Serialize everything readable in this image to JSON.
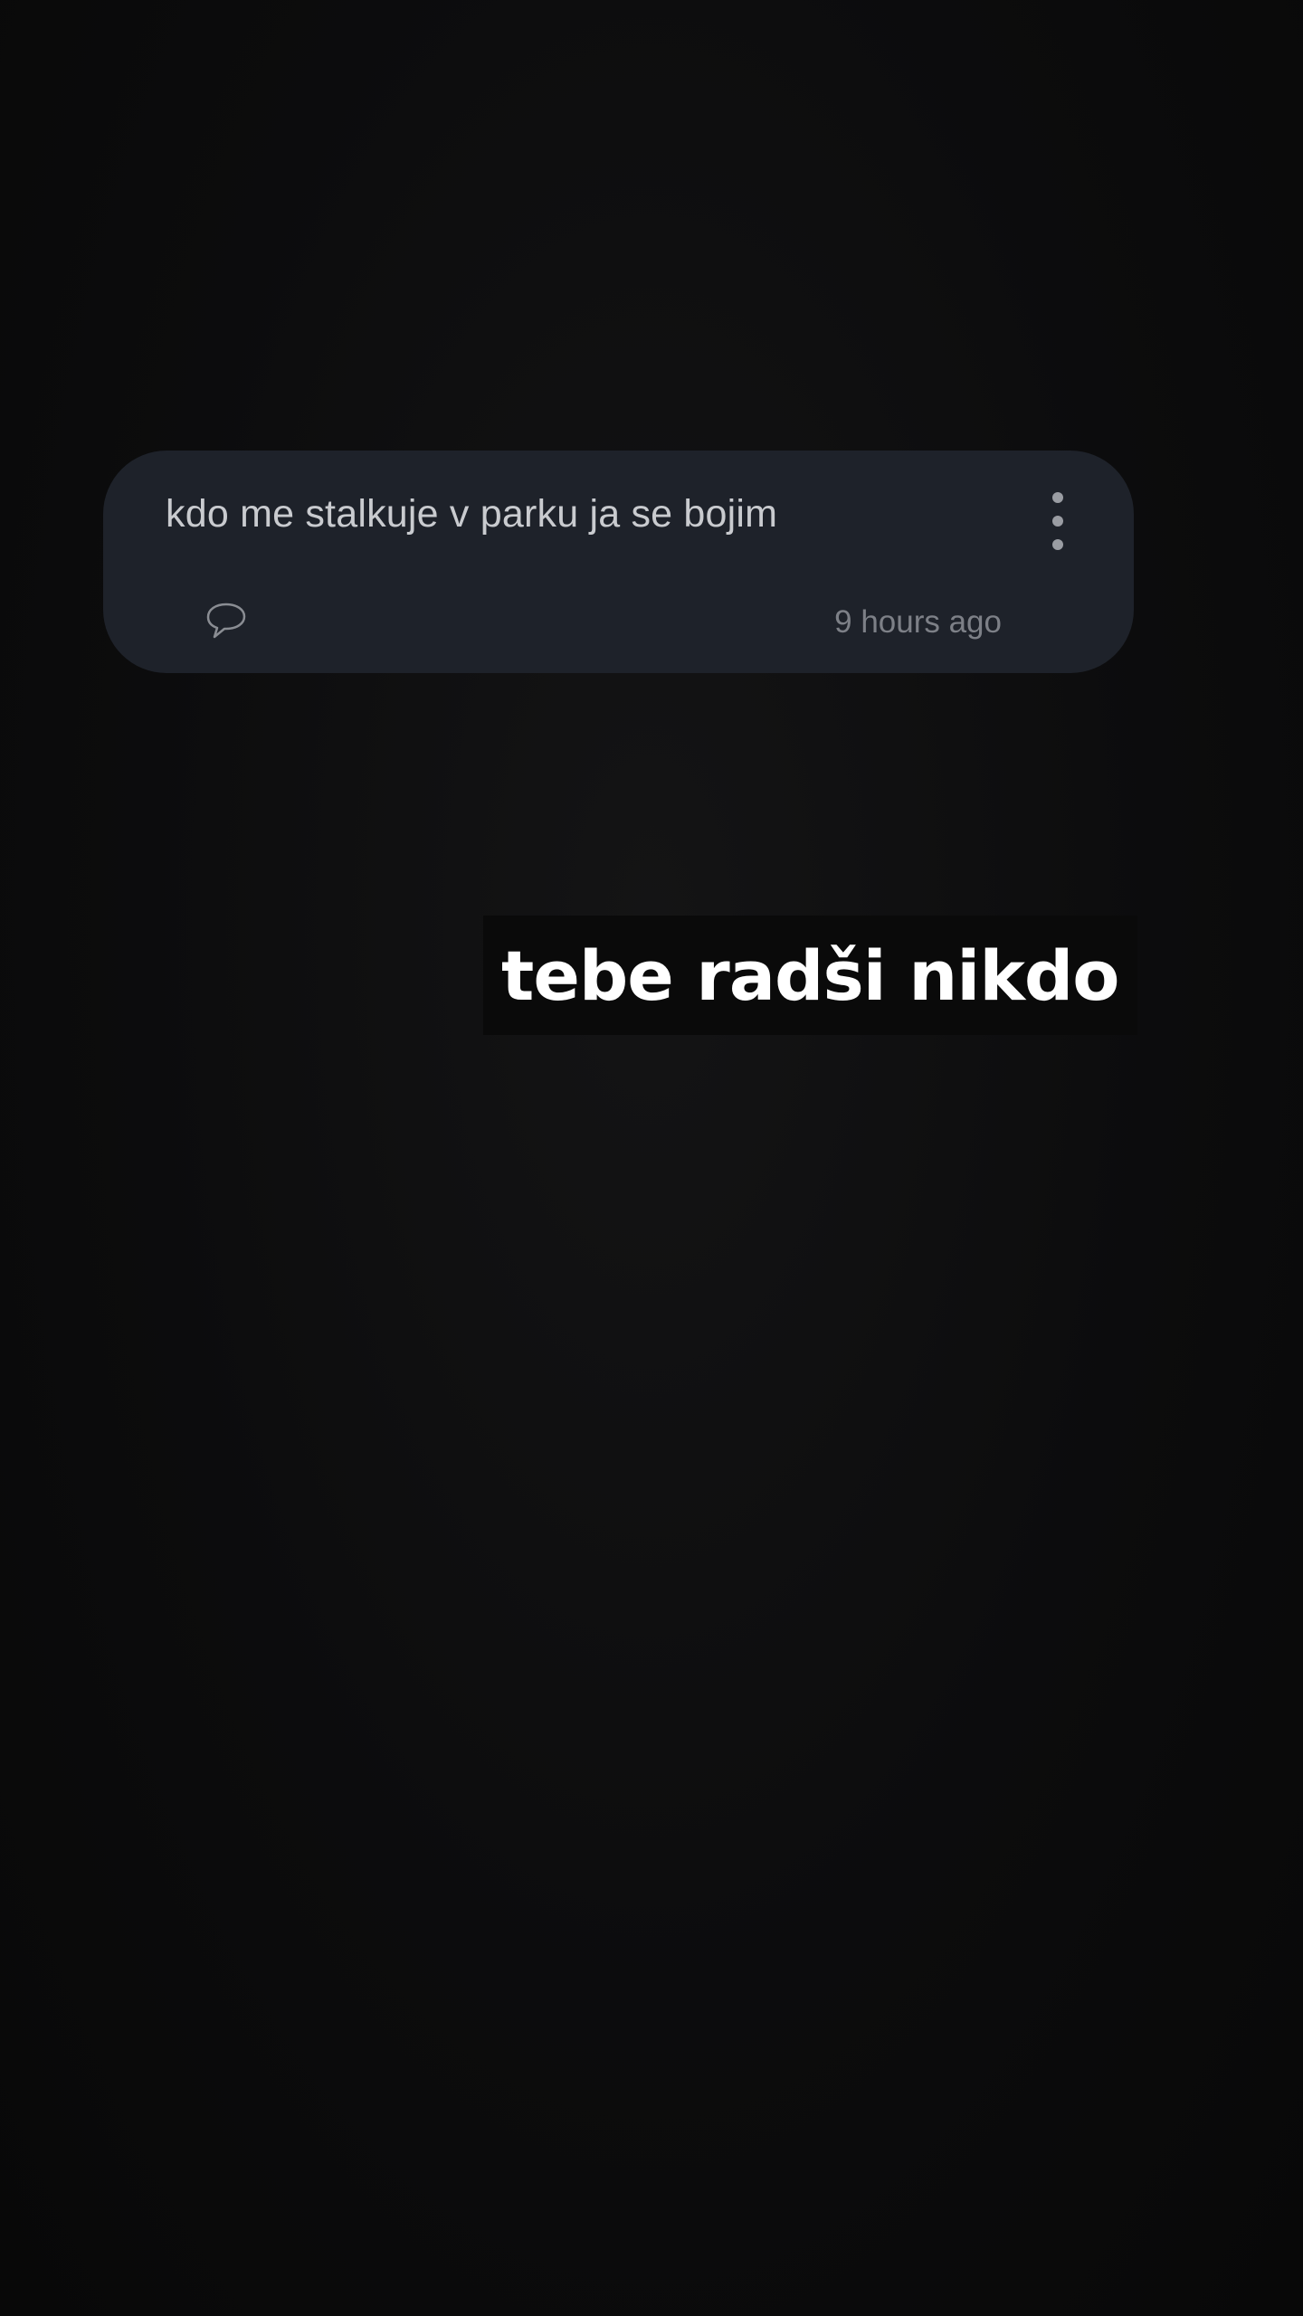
{
  "question": {
    "text": "kdo me stalkuje v parku ja se bojim",
    "timestamp": "9 hours ago",
    "reply_icon": "speech-bubble-icon",
    "menu_icon": "more-vertical-icon"
  },
  "answer": {
    "text": "tebe radši nikdo"
  },
  "colors": {
    "background": "#0b0b0c",
    "card": "#1e222a",
    "question_text": "#c9cbcf",
    "timestamp_text": "#7d8087",
    "answer_text": "#ffffff"
  }
}
